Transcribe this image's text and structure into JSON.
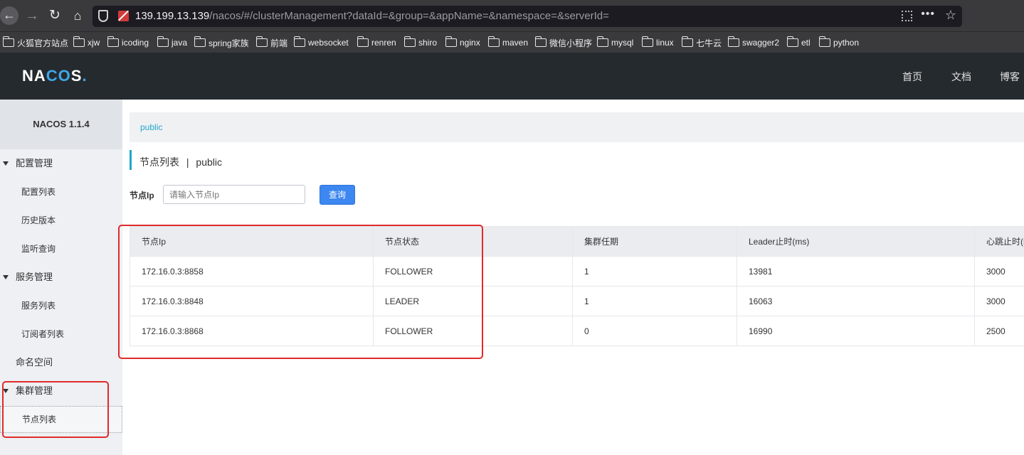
{
  "browser": {
    "url_host": "139.199.13.139",
    "url_path": "/nacos/#/clusterManagement?dataId=&group=&appName=&namespace=&serverId="
  },
  "bookmarks": [
    {
      "label": "火狐官方站点"
    },
    {
      "label": "xjw"
    },
    {
      "label": "icoding"
    },
    {
      "label": "java"
    },
    {
      "label": "spring家族"
    },
    {
      "label": "前端"
    },
    {
      "label": "websocket"
    },
    {
      "label": "renren"
    },
    {
      "label": "shiro"
    },
    {
      "label": "nginx"
    },
    {
      "label": "maven"
    },
    {
      "label": "微信小程序"
    },
    {
      "label": "mysql"
    },
    {
      "label": "linux"
    },
    {
      "label": "七牛云"
    },
    {
      "label": "swagger2"
    },
    {
      "label": "etl"
    },
    {
      "label": "python"
    }
  ],
  "header": {
    "nav": [
      "首页",
      "文档",
      "博客"
    ]
  },
  "sidebar": {
    "title": "NACOS 1.1.4",
    "groups": [
      {
        "label": "配置管理",
        "items": [
          "配置列表",
          "历史版本",
          "监听查询"
        ]
      },
      {
        "label": "服务管理",
        "items": [
          "服务列表",
          "订阅者列表"
        ]
      },
      {
        "label": "命名空间",
        "items": []
      },
      {
        "label": "集群管理",
        "items": [
          "节点列表"
        ]
      }
    ]
  },
  "main": {
    "namespace": "public",
    "title_prefix": "节点列表",
    "title_sep": "|",
    "title_ns": "public",
    "filter_label": "节点Ip",
    "filter_placeholder": "请输入节点Ip",
    "query_button": "查询",
    "table": {
      "headers": [
        "节点Ip",
        "节点状态",
        "集群任期",
        "Leader止时(ms)",
        "心跳止时(ms)"
      ],
      "rows": [
        [
          "172.16.0.3:8858",
          "FOLLOWER",
          "1",
          "13981",
          "3000"
        ],
        [
          "172.16.0.3:8848",
          "LEADER",
          "1",
          "16063",
          "3000"
        ],
        [
          "172.16.0.3:8868",
          "FOLLOWER",
          "0",
          "16990",
          "2500"
        ]
      ]
    }
  },
  "colors": {
    "accent": "#21a7c9",
    "primary_button": "#3c87f0",
    "header_bg": "#252a2f",
    "annotation_red": "#e02a2a"
  }
}
